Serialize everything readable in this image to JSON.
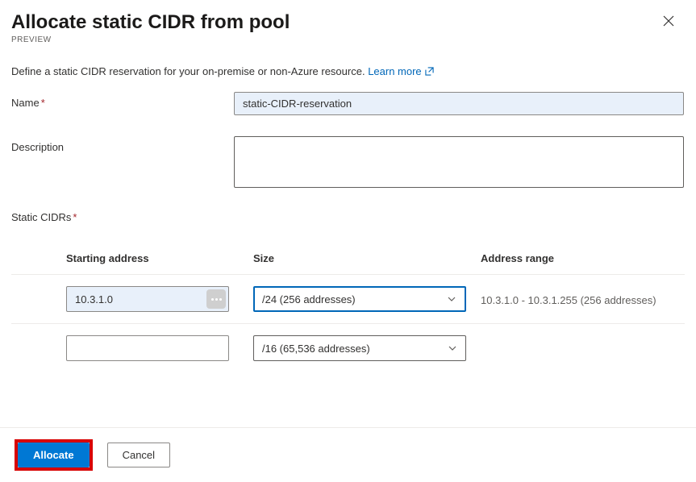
{
  "header": {
    "title": "Allocate static CIDR from pool",
    "badge": "PREVIEW"
  },
  "help": {
    "text": "Define a static CIDR reservation for your on-premise or non-Azure resource. ",
    "link_text": "Learn more"
  },
  "fields": {
    "name": {
      "label": "Name",
      "value": "static-CIDR-reservation"
    },
    "description": {
      "label": "Description",
      "value": ""
    },
    "static_cidrs": {
      "label": "Static CIDRs"
    }
  },
  "table": {
    "headers": {
      "starting_address": "Starting address",
      "size": "Size",
      "address_range": "Address range"
    },
    "rows": [
      {
        "starting_address": "10.3.1.0",
        "size_label": "/24 (256 addresses)",
        "address_range": "10.3.1.0 - 10.3.1.255 (256 addresses)",
        "active": true,
        "has_action": true
      },
      {
        "starting_address": "",
        "size_label": "/16 (65,536 addresses)",
        "address_range": "",
        "active": false,
        "has_action": false
      }
    ]
  },
  "footer": {
    "allocate": "Allocate",
    "cancel": "Cancel"
  }
}
